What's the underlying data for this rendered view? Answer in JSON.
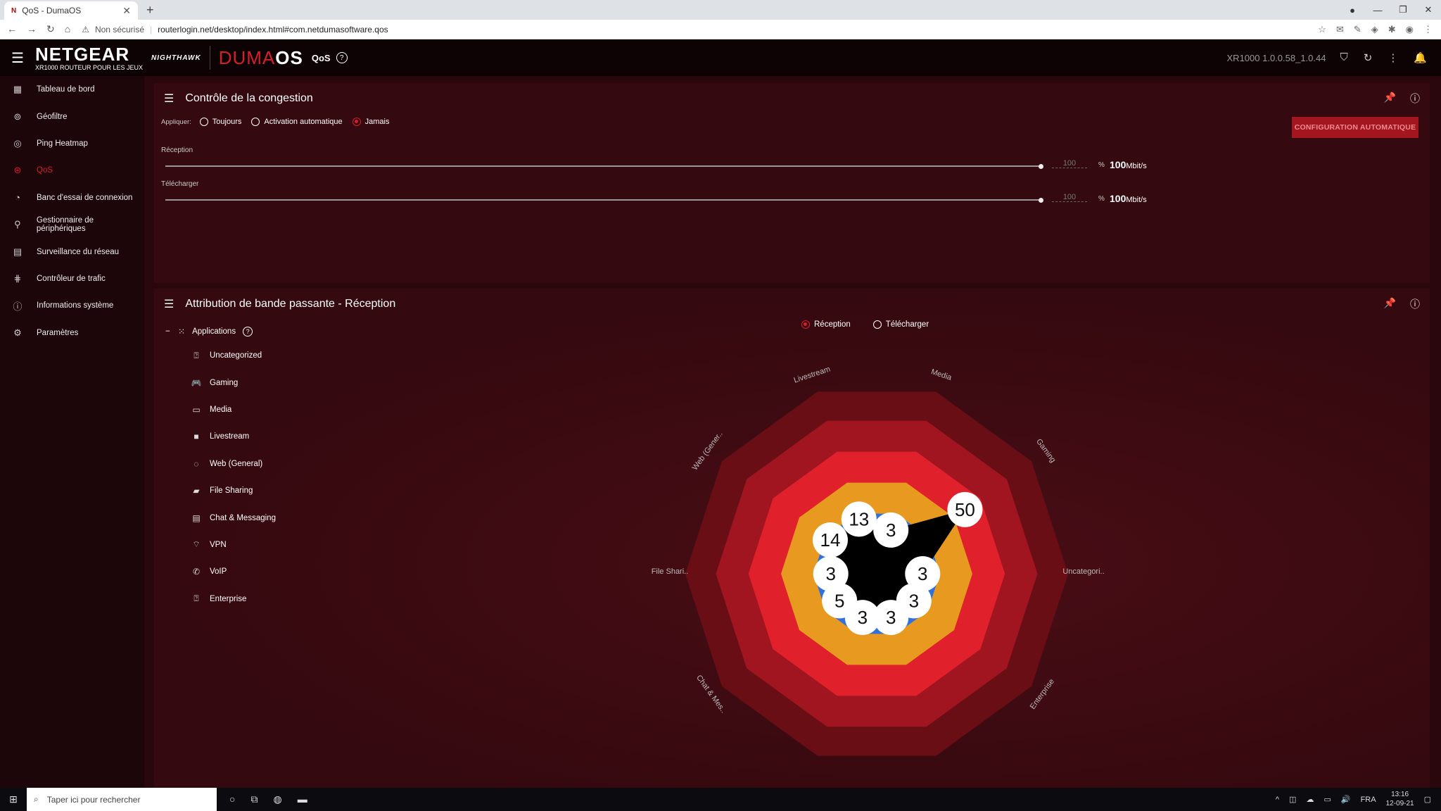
{
  "browser": {
    "tab_title": "QoS - DumaOS",
    "tab_favicon": "N",
    "insecure_label": "Non sécurisé",
    "url": "routerlogin.net/desktop/index.html#com.netdumasoftware.qos"
  },
  "header": {
    "brand": "NETGEAR",
    "brand_sub": "XR1000 ROUTEUR POUR LES JEUX",
    "nighthawk": "NIGHTHAWK",
    "duma_red": "DUMA",
    "duma_white": "OS",
    "app_name": "QoS",
    "version": "XR1000 1.0.0.58_1.0.44"
  },
  "sidebar": {
    "items": [
      {
        "label": "Tableau de bord",
        "icon": "dashboard-icon"
      },
      {
        "label": "Géofiltre",
        "icon": "geofilter-icon"
      },
      {
        "label": "Ping Heatmap",
        "icon": "ping-heatmap-icon"
      },
      {
        "label": "QoS",
        "icon": "qos-icon"
      },
      {
        "label": "Banc d'essai de connexion",
        "icon": "benchmark-icon"
      },
      {
        "label": "Gestionnaire de périphériques",
        "icon": "device-manager-icon"
      },
      {
        "label": "Surveillance du réseau",
        "icon": "network-monitor-icon"
      },
      {
        "label": "Contrôleur de trafic",
        "icon": "traffic-controller-icon"
      },
      {
        "label": "Informations système",
        "icon": "system-info-icon"
      },
      {
        "label": "Paramètres",
        "icon": "settings-icon"
      }
    ],
    "active_index": 3
  },
  "congestion": {
    "title": "Contrôle de la congestion",
    "apply_label": "Appliquer:",
    "options": [
      "Toujours",
      "Activation automatique",
      "Jamais"
    ],
    "selected": "Jamais",
    "auto_button": "CONFIGURATION AUTOMATIQUE",
    "download": {
      "label": "Réception",
      "percent": "100",
      "pct_sign": "%",
      "speed": "100",
      "unit": "Mbit/s",
      "fraction": 1.0
    },
    "upload": {
      "label": "Télécharger",
      "percent": "100",
      "pct_sign": "%",
      "speed": "100",
      "unit": "Mbit/s",
      "fraction": 1.0
    }
  },
  "bandwidth": {
    "title": "Attribution de bande passante - Réception",
    "tree_root": "Applications",
    "categories": [
      {
        "label": "Uncategorized",
        "icon": "unknown-icon"
      },
      {
        "label": "Gaming",
        "icon": "gamepad-icon"
      },
      {
        "label": "Media",
        "icon": "monitor-icon"
      },
      {
        "label": "Livestream",
        "icon": "camera-icon"
      },
      {
        "label": "Web (General)",
        "icon": "globe-icon"
      },
      {
        "label": "File Sharing",
        "icon": "folder-icon"
      },
      {
        "label": "Chat & Messaging",
        "icon": "chat-icon"
      },
      {
        "label": "VPN",
        "icon": "wifi-shield-icon"
      },
      {
        "label": "VoIP",
        "icon": "phone-icon"
      },
      {
        "label": "Enterprise",
        "icon": "building-icon"
      }
    ],
    "toggle": {
      "options": [
        "Réception",
        "Télécharger"
      ],
      "selected": "Réception"
    }
  },
  "chart_data": {
    "type": "radar",
    "axes": [
      "Livestream",
      "Media",
      "Gaming",
      "Uncategori..",
      "Enterprise",
      "",
      "",
      "Chat & Mes..",
      "File Shari..",
      "Web (Gener.."
    ],
    "values": [
      13,
      3,
      50,
      3,
      3,
      3,
      3,
      5,
      3,
      14
    ],
    "max": 100,
    "ring_colors": [
      "#3070e0",
      "#e89a20",
      "#e0202a",
      "#a01520",
      "#6a0e16"
    ]
  },
  "taskbar": {
    "search_placeholder": "Taper ici pour rechercher",
    "lang": "FRA",
    "time": "13:16",
    "date": "12-09-21"
  }
}
